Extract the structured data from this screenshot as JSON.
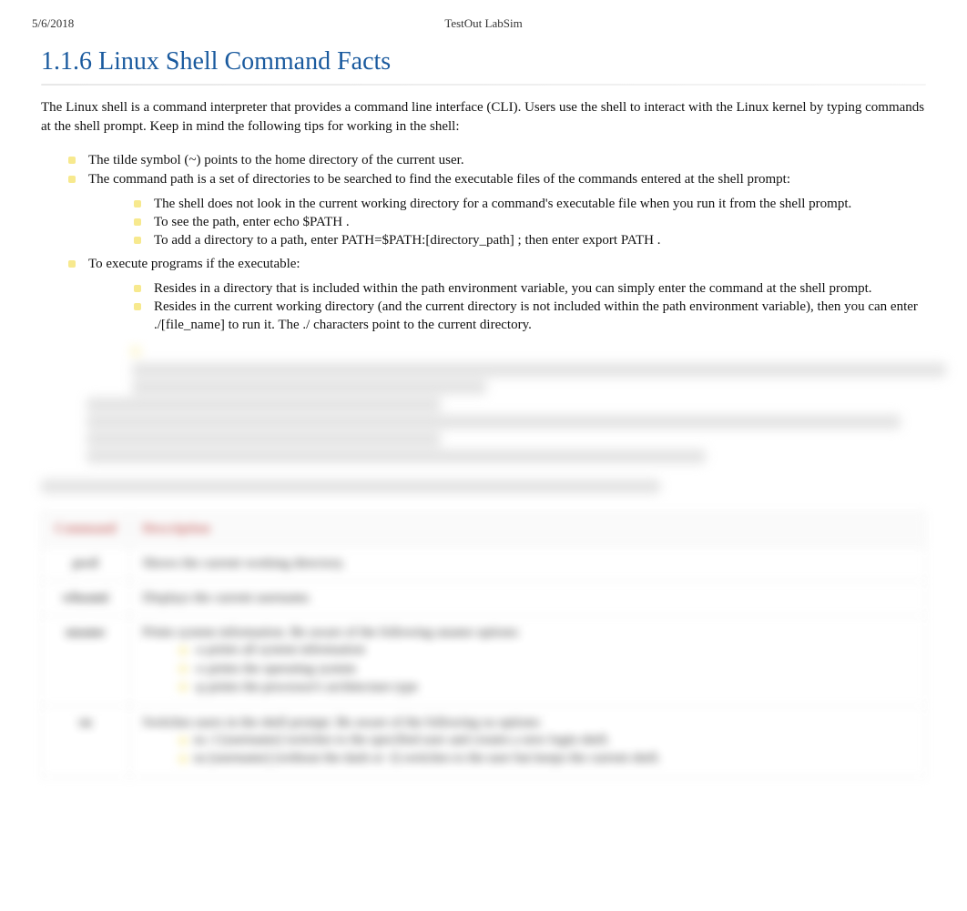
{
  "header": {
    "date": "5/6/2018",
    "title": "TestOut LabSim"
  },
  "heading": "1.1.6 Linux Shell Command Facts",
  "intro": "The Linux shell is a command interpreter that provides a command line interface (CLI). Users use the shell to interact with the Linux kernel by typing commands at the shell prompt. Keep in mind the following tips for working in the shell:",
  "bullets": {
    "b1": "The tilde symbol (~) points to the home directory of the current user.",
    "b2": "The command path is a set of directories to be searched to find the executable files of the commands entered at the shell prompt:",
    "b2_sub": {
      "s1": "The shell does not look in the current working directory for a command's executable file when you run it from the shell prompt.",
      "s2": "To see the path, enter echo $PATH  .",
      "s3": "To add a directory to a path, enter PATH=$PATH:[directory_path]     ; then enter export PATH  ."
    },
    "b3": "To execute programs if the executable:",
    "b3_sub": {
      "s1": "Resides in a directory that is included within the path environment variable, you can simply enter the command at the shell prompt.",
      "s2": "Resides in the current working directory (and the current directory is not included within the path environment variable), then you can enter ./[file_name] to run it. The ./ characters point to the current directory."
    }
  },
  "blurred": {
    "intro_line": "The following table describes several common commands used from the shell.",
    "table": {
      "headers": {
        "col1": "Command",
        "col2": "Description"
      },
      "rows": [
        {
          "cmd": "pwd",
          "desc": "Shows the current working directory."
        },
        {
          "cmd": "whoami",
          "desc": "Displays the current username."
        },
        {
          "cmd": "uname",
          "desc_intro": "Prints system information. Be aware of the following uname options:",
          "items": [
            "-a prints all system information",
            "-o prints the operating system",
            "-p prints the processor's architecture type"
          ]
        },
        {
          "cmd": "su",
          "desc_intro": "Switches users in the shell prompt. Be aware of the following su options:",
          "items": [
            "su -l [username]   switches to the specified user and creates a new login shell.",
            "su [username]   (without the dash or -l) switches to the user but keeps the current shell."
          ]
        }
      ]
    }
  }
}
